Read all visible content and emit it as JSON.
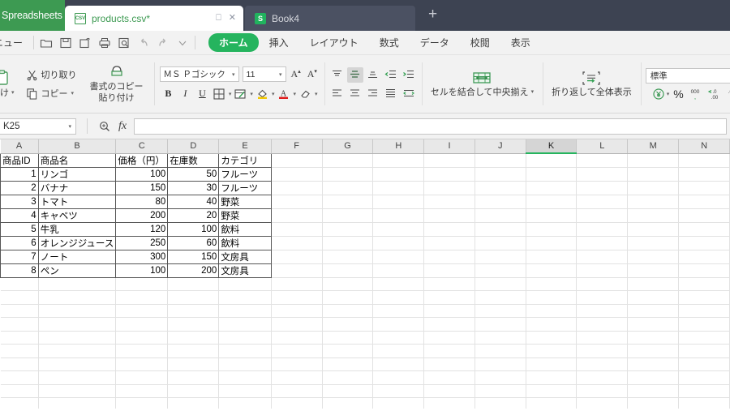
{
  "window": {
    "brand_tab": "Spreadsheets",
    "tabs": [
      {
        "label": "products.csv*",
        "icon": "csv-file-icon",
        "active": true,
        "close": "✕",
        "detach": "⎕"
      },
      {
        "label": "Book4",
        "icon": "spreadsheet-s-icon",
        "active": false
      }
    ],
    "new_tab": "+",
    "colors": {
      "brand_green": "#3d9a52",
      "accent_green": "#25b45e",
      "tabbar_bg": "#3d4352"
    }
  },
  "menu": {
    "menu_label": "ニュー",
    "quick_access": [
      "open-folder-icon",
      "save-icon",
      "save-as-icon",
      "print-icon",
      "print-preview-icon",
      "undo-icon",
      "redo-icon",
      "customize-caret-icon"
    ],
    "ribbon_tabs": [
      {
        "label": "ホーム",
        "selected": true
      },
      {
        "label": "挿入",
        "selected": false
      },
      {
        "label": "レイアウト",
        "selected": false
      },
      {
        "label": "数式",
        "selected": false
      },
      {
        "label": "データ",
        "selected": false
      },
      {
        "label": "校閲",
        "selected": false
      },
      {
        "label": "表示",
        "selected": false
      }
    ]
  },
  "ribbon": {
    "clipboard": {
      "paste_label": "付け",
      "cut_label": "切り取り",
      "copy_label": "コピー",
      "format_painter_line1": "書式のコピー",
      "format_painter_line2": "貼り付け"
    },
    "font": {
      "family": "ＭＳ Ｐゴシック",
      "size": "11",
      "grow_label": "A",
      "shrink_label": "A",
      "bold": "B",
      "italic": "I",
      "underline": "U",
      "borders_icon": "borders-icon",
      "cell_style_icon": "cell-style-icon",
      "fill_icon": "fill-color-icon",
      "font_color": "A",
      "clear_icon": "clear-format-icon"
    },
    "alignment": {
      "merge_center_label": "セルを結合して中央揃え",
      "top_align_icon": "align-top-icon",
      "middle_align_icon": "align-middle-icon",
      "bottom_align_icon": "align-bottom-icon",
      "decrease_indent_icon": "decrease-indent-icon",
      "increase_indent_icon": "increase-indent-icon",
      "left_align_icon": "align-left-icon",
      "center_align_icon": "align-center-icon",
      "right_align_icon": "align-right-icon",
      "justify_icon": "justify-icon",
      "distribute_icon": "distribute-icon"
    },
    "wrap": {
      "label": "折り返して全体表示",
      "icon": "wrap-text-icon"
    },
    "number": {
      "format": "標準",
      "currency_icon": "currency-icon",
      "percent": "%",
      "comma": "000",
      "increase_decimal": ".00",
      "decrease_decimal": ".00"
    }
  },
  "formula_bar": {
    "name_box": "K25",
    "search_icon": "search-icon",
    "fx_label": "fx",
    "formula_value": "",
    "formula_placeholder": ""
  },
  "sheet": {
    "columns": [
      "A",
      "B",
      "C",
      "D",
      "E",
      "F",
      "G",
      "H",
      "I",
      "J",
      "K",
      "L",
      "M",
      "N"
    ],
    "selected_column": "K",
    "selected_cell": "K25",
    "headers": [
      "商品ID",
      "商品名",
      "価格（円）",
      "在庫数",
      "カテゴリ"
    ],
    "rows": [
      {
        "id": "1",
        "name": "リンゴ",
        "price": "100",
        "stock": "50",
        "category": "フルーツ"
      },
      {
        "id": "2",
        "name": "バナナ",
        "price": "150",
        "stock": "30",
        "category": "フルーツ"
      },
      {
        "id": "3",
        "name": "トマト",
        "price": "80",
        "stock": "40",
        "category": "野菜"
      },
      {
        "id": "4",
        "name": "キャベツ",
        "price": "200",
        "stock": "20",
        "category": "野菜"
      },
      {
        "id": "5",
        "name": "牛乳",
        "price": "120",
        "stock": "100",
        "category": "飲料"
      },
      {
        "id": "6",
        "name": "オレンジジュース",
        "price": "250",
        "stock": "60",
        "category": "飲料"
      },
      {
        "id": "7",
        "name": "ノート",
        "price": "300",
        "stock": "150",
        "category": "文房具"
      },
      {
        "id": "8",
        "name": "ペン",
        "price": "100",
        "stock": "200",
        "category": "文房具"
      }
    ]
  }
}
